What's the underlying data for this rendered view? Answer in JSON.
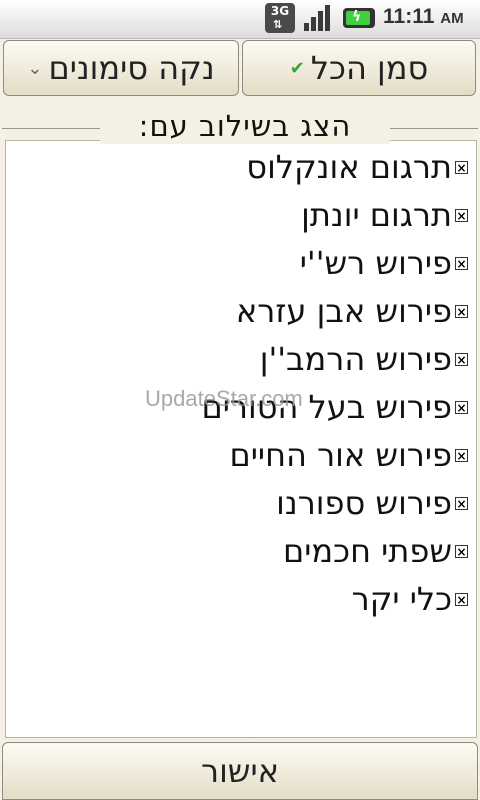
{
  "status_bar": {
    "network": "3G",
    "network_arrows": "⇅",
    "battery_icon": "charging-battery-icon",
    "time": "11:11",
    "ampm": "AM"
  },
  "buttons": {
    "select_all": "סמן הכל",
    "clear_marks": "נקה סימונים",
    "confirm": "אישור"
  },
  "group_label": "הצג בשילוב עם:",
  "items": [
    {
      "label": "תרגום אונקלוס",
      "checked": true
    },
    {
      "label": "תרגום יונתן",
      "checked": true
    },
    {
      "label": "פירוש רש''י",
      "checked": true
    },
    {
      "label": "פירוש אבן עזרא",
      "checked": true
    },
    {
      "label": "פירוש הרמב''ן",
      "checked": true
    },
    {
      "label": "פירוש בעל הטורים",
      "checked": true
    },
    {
      "label": "פירוש אור החיים",
      "checked": true
    },
    {
      "label": "פירוש ספורנו",
      "checked": true
    },
    {
      "label": "שפתי חכמים",
      "checked": true
    },
    {
      "label": "כלי יקר",
      "checked": true
    }
  ],
  "watermark": "UpdateStar.com",
  "colors": {
    "background": "#f4f0e3",
    "list_background": "#ffffff",
    "check_green": "#3aa33a"
  }
}
